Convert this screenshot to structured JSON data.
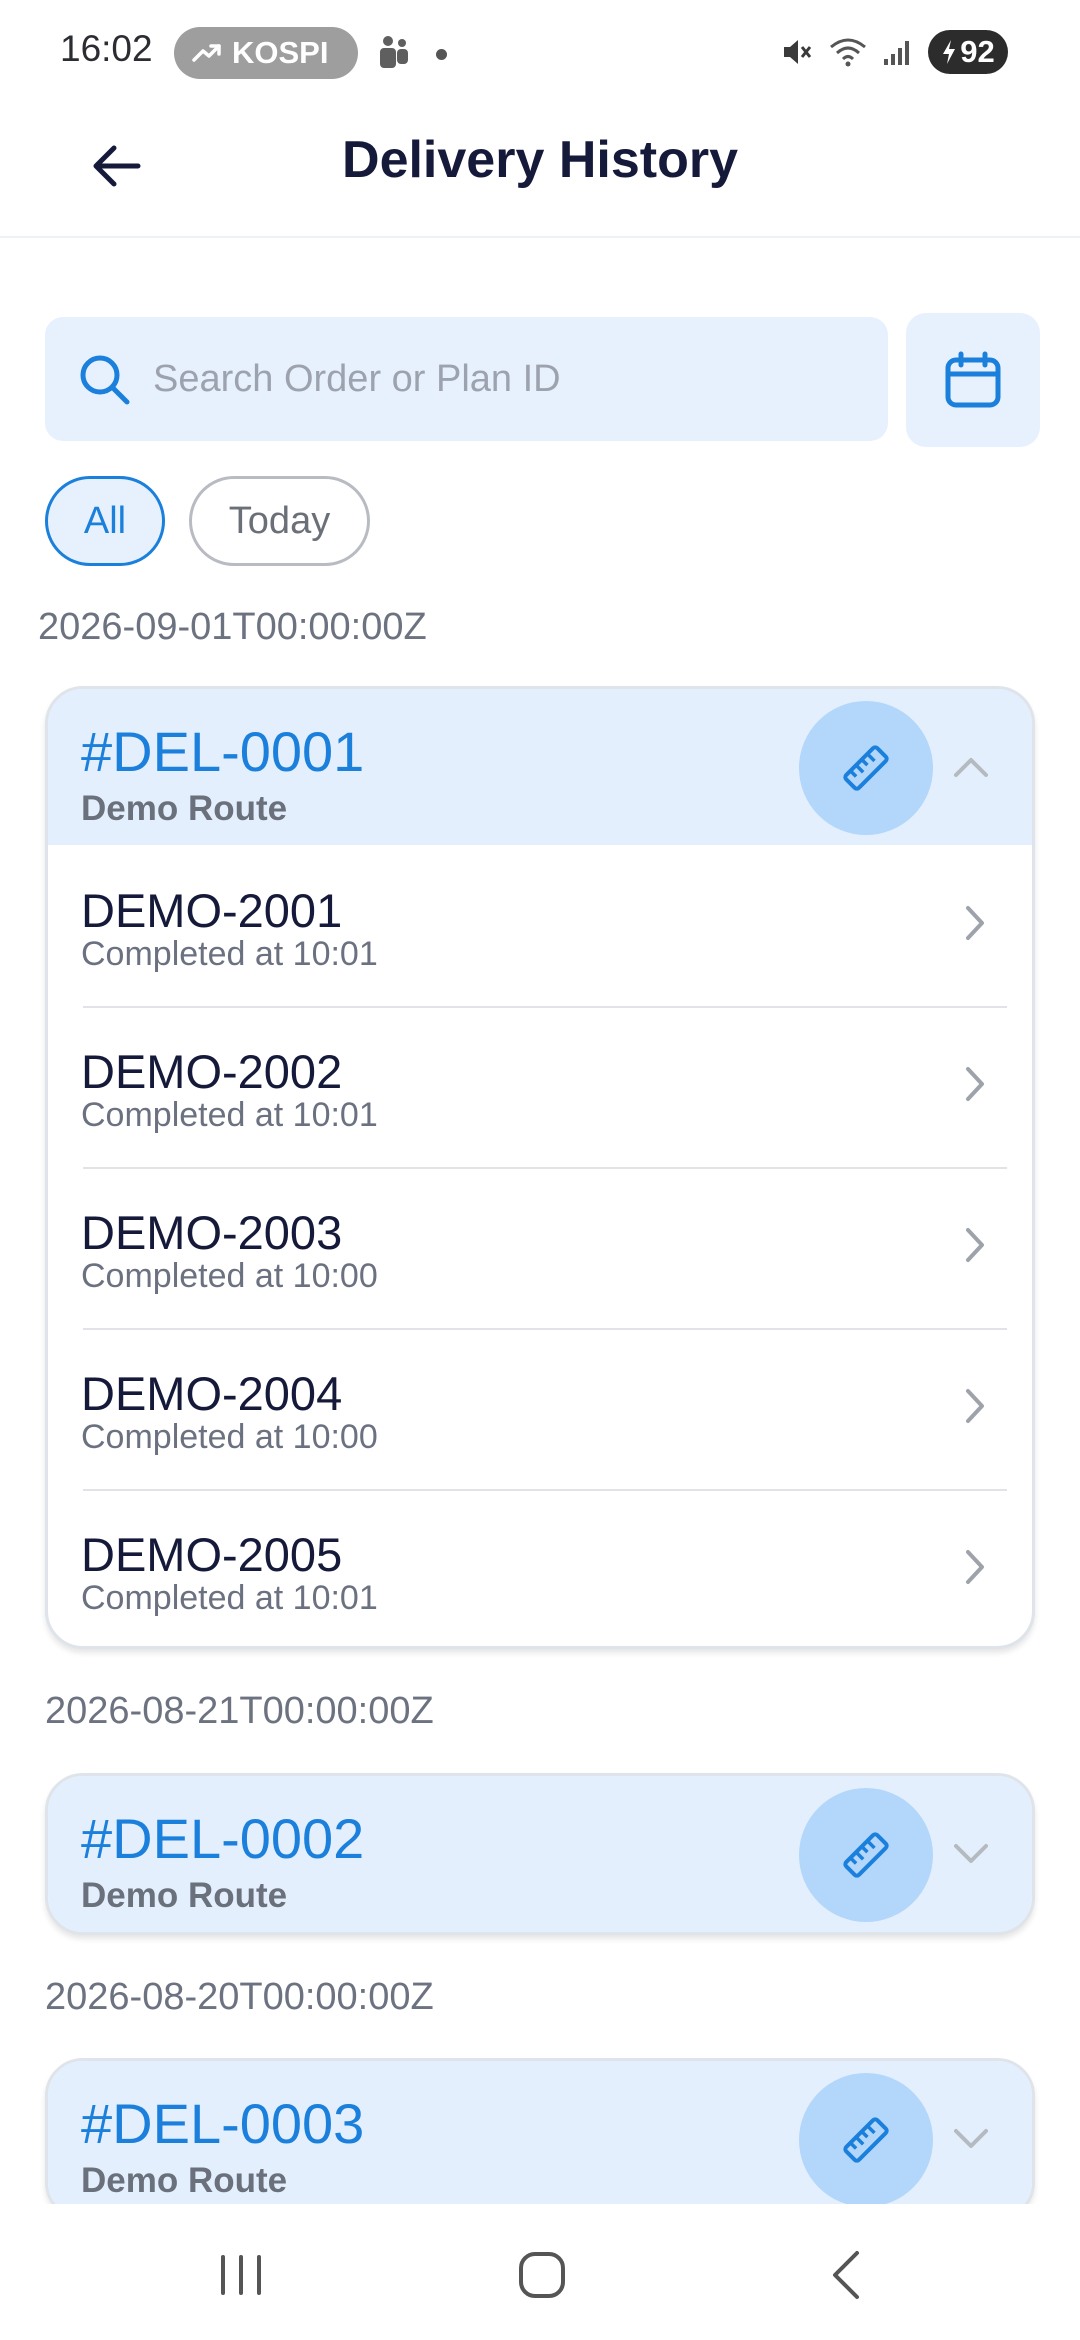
{
  "status_bar": {
    "time": "16:02",
    "ticker_label": "KOSPI",
    "battery": "92"
  },
  "app_bar": {
    "title": "Delivery History"
  },
  "search": {
    "placeholder": "Search Order or Plan ID",
    "value": ""
  },
  "filters": {
    "all_label": "All",
    "today_label": "Today",
    "selected": "All"
  },
  "groups": [
    {
      "date": "2026-09-01T00:00:00Z",
      "delivery": {
        "id": "#DEL-0001",
        "route": "Demo Route",
        "expanded": true,
        "orders": [
          {
            "id": "DEMO-2001",
            "status": "Completed at 10:01"
          },
          {
            "id": "DEMO-2002",
            "status": "Completed at 10:01"
          },
          {
            "id": "DEMO-2003",
            "status": "Completed at 10:00"
          },
          {
            "id": "DEMO-2004",
            "status": "Completed at 10:00"
          },
          {
            "id": "DEMO-2005",
            "status": "Completed at 10:01"
          }
        ]
      }
    },
    {
      "date": "2026-08-21T00:00:00Z",
      "delivery": {
        "id": "#DEL-0002",
        "route": "Demo Route",
        "expanded": false
      }
    },
    {
      "date": "2026-08-20T00:00:00Z",
      "delivery": {
        "id": "#DEL-0003",
        "route": "Demo Route",
        "expanded": false
      }
    }
  ],
  "colors": {
    "accent": "#1b7fdc",
    "card_header_bg": "#e3effc",
    "input_bg": "#e7f1fd",
    "title_text": "#161a3a",
    "muted_text": "#6c7280"
  },
  "icons": {
    "back": "arrow-left-icon",
    "search": "search-icon",
    "calendar": "calendar-icon",
    "measure": "ruler-icon",
    "expand": "chevron-up-icon",
    "collapse": "chevron-down-icon",
    "row": "chevron-right-icon"
  }
}
